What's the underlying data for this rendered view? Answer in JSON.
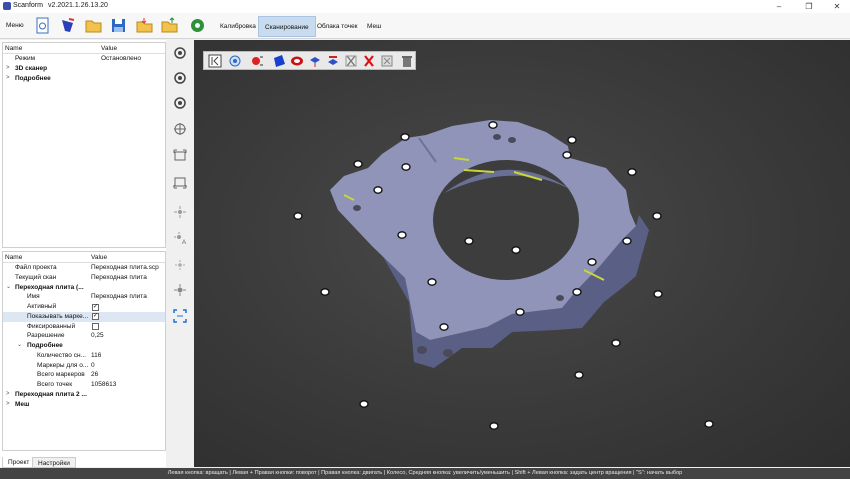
{
  "titlebar": {
    "app_name": "Scanform",
    "version": "v2.2021.1.26.13.20"
  },
  "toolbar": {
    "menu_label": "Меню",
    "mode_tabs": [
      {
        "label": "Калибровка",
        "active": false
      },
      {
        "label": "Сканирование",
        "active": true
      },
      {
        "label": "Облака точек",
        "active": false
      },
      {
        "label": "Меш",
        "active": false
      }
    ]
  },
  "top_tree": {
    "col_name": "Name",
    "col_value": "Value",
    "rows": [
      {
        "name": "Режим",
        "value": "Остановлено"
      },
      {
        "name": "3D сканер",
        "value": ""
      },
      {
        "name": "Подробнее",
        "value": ""
      }
    ]
  },
  "bottom_tree": {
    "col_name": "Name",
    "col_value": "Value",
    "rows": [
      {
        "name": "Файл проекта",
        "value": "Переходная плита.scp"
      },
      {
        "name": "Текущий скан",
        "value": "Переходная плита"
      },
      {
        "name": "Переходная плита (...",
        "value": ""
      },
      {
        "name": "Имя",
        "value": "Переходная плита"
      },
      {
        "name": "Активный",
        "value": ""
      },
      {
        "name": "Показывать марке...",
        "value": ""
      },
      {
        "name": "Фиксированный",
        "value": ""
      },
      {
        "name": "Разрешение",
        "value": "0,25"
      },
      {
        "name": "Подробнее",
        "value": ""
      },
      {
        "name": "Количество сн...",
        "value": "116"
      },
      {
        "name": "Маркеры для о...",
        "value": "0"
      },
      {
        "name": "Всего маркеров",
        "value": "26"
      },
      {
        "name": "Всего точек",
        "value": "1058613"
      },
      {
        "name": "Переходная плита 2 ...",
        "value": ""
      },
      {
        "name": "Меш",
        "value": ""
      }
    ]
  },
  "bottom_tabs": [
    "Проект",
    "Настройки"
  ],
  "statusbar": {
    "text": "Левая кнопка: вращать  |  Левая + Правая кнопки: поворот  |  Правая кнопка: двигать  |  Колесо, Средняя кнопка: увеличить/уменьшить  |  Shift + Левая кнопка: задать центр вращения  |  \"S\": начать выбор"
  },
  "colors": {
    "accent": "#c9dcef",
    "model": "#8f94b8",
    "viewport_bg": "#3a3a3a"
  }
}
